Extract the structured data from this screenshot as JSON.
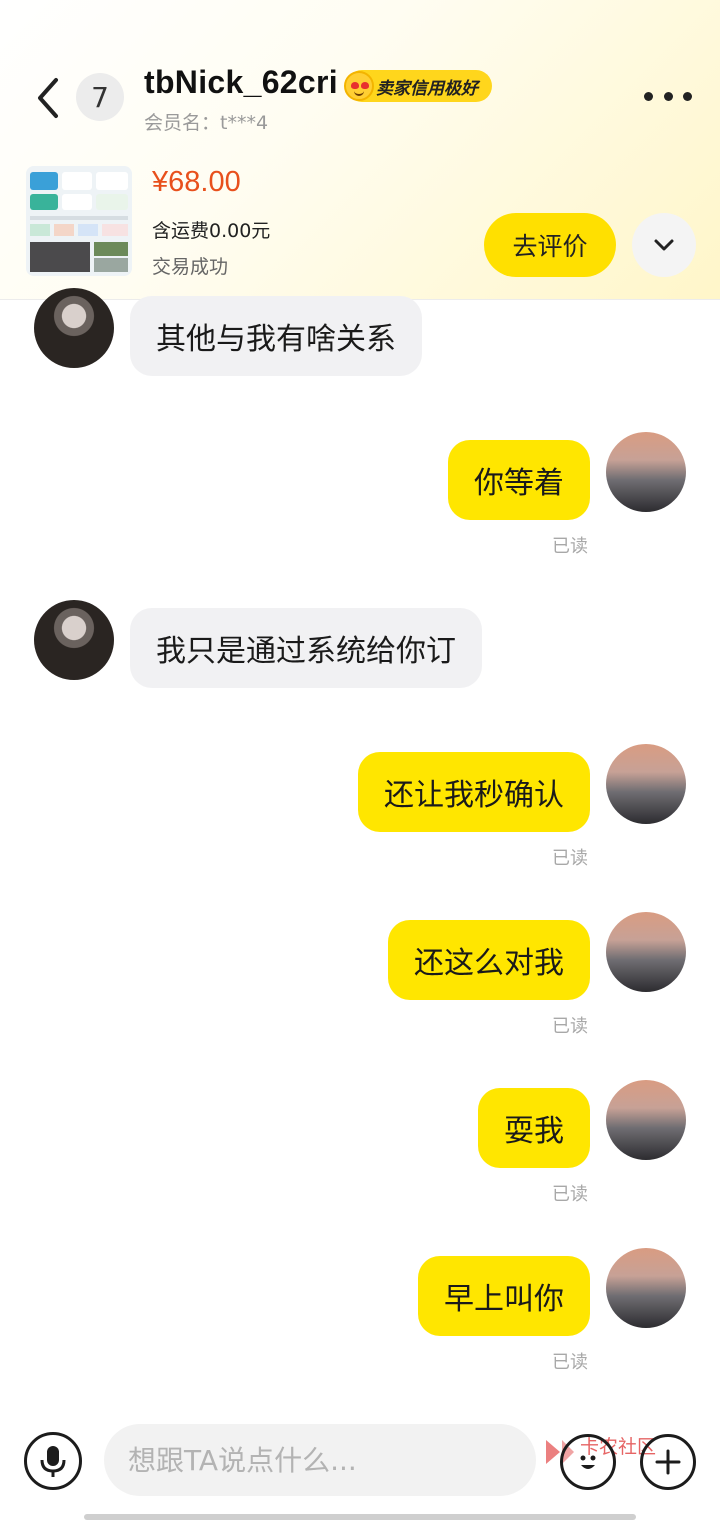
{
  "header": {
    "unread_count": "7",
    "nickname": "tbNick_62cri",
    "credit_badge": "卖家信用极好",
    "member_name": "会员名：t***4"
  },
  "order": {
    "price": "¥68.00",
    "shipping": "含运费0.00元",
    "status": "交易成功",
    "review_label": "去评价"
  },
  "messages": [
    {
      "side": "in",
      "text": "其他与我有啥关系"
    },
    {
      "side": "out",
      "text": "你等着",
      "read": "已读"
    },
    {
      "side": "in",
      "text": "我只是通过系统给你订"
    },
    {
      "side": "out",
      "text": "还让我秒确认",
      "read": "已读"
    },
    {
      "side": "out",
      "text": "还这么对我",
      "read": "已读"
    },
    {
      "side": "out",
      "text": "耍我",
      "read": "已读"
    },
    {
      "side": "out",
      "text": "早上叫你",
      "read": "已读"
    }
  ],
  "input": {
    "placeholder": "想跟TA说点什么..."
  },
  "watermark": "卡农社区",
  "colors": {
    "accent": "#ffe600",
    "price": "#e8501c"
  },
  "icons": [
    "back-arrow-icon",
    "more-icon",
    "chevron-down-icon",
    "mic-icon",
    "emoji-icon",
    "plus-icon"
  ]
}
